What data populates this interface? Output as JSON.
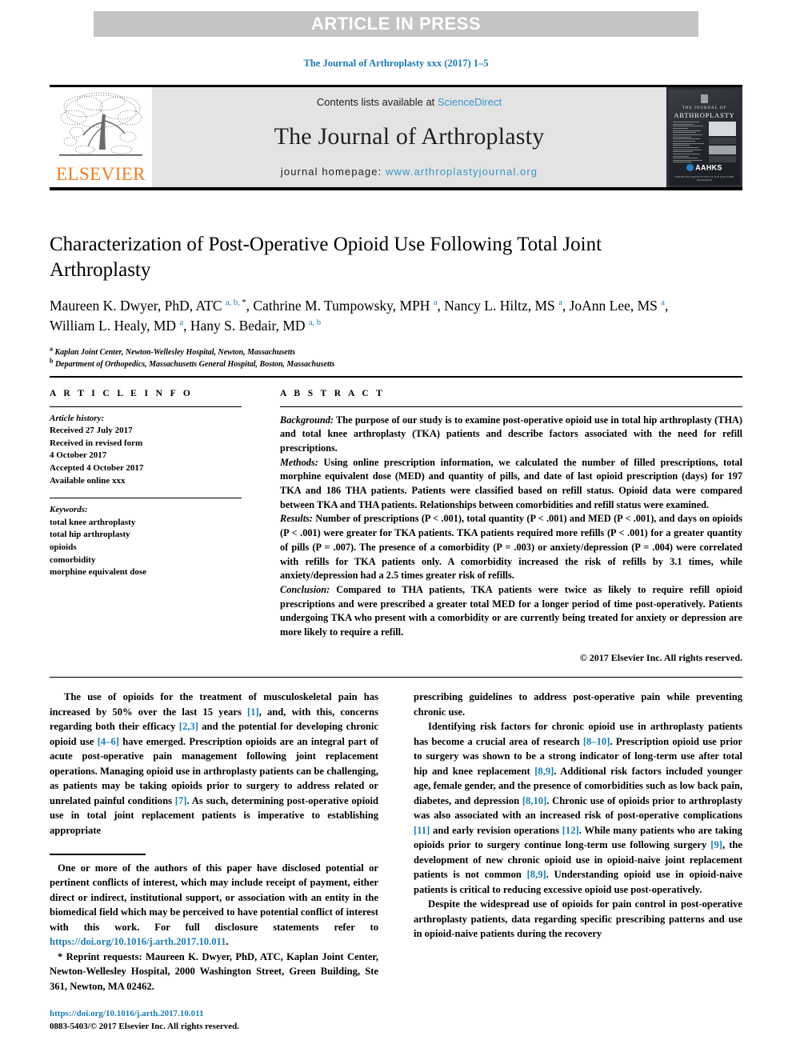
{
  "banner": {
    "text": "ARTICLE IN PRESS"
  },
  "citation": {
    "text": "The Journal of Arthroplasty xxx (2017) 1–5"
  },
  "masthead": {
    "publisher_logo_word": "ELSEVIER",
    "contents_prefix": "Contents lists available at ",
    "contents_link": "ScienceDirect",
    "journal_title": "The Journal of Arthroplasty",
    "homepage_prefix": "journal homepage: ",
    "homepage_link": "www.arthroplastyjournal.org",
    "cover": {
      "line1": "THE JOURNAL OF",
      "line2": "ARTHROPLASTY",
      "society": "AAHKS",
      "society_sub": "AMERICAN ASSOCIATION OF HIP AND KNEE SURGEONS"
    },
    "link_color": "#3a95c7",
    "logo_color": "#ef7d21"
  },
  "article": {
    "title": "Characterization of Post-Operative Opioid Use Following Total Joint Arthroplasty",
    "authors_html": "Maureen K. Dwyer, PhD, ATC <sup>a, b, </sup><sup class=\"star\">*</sup>, Cathrine M. Tumpowsky, MPH <sup>a</sup>, Nancy L. Hiltz, MS <sup>a</sup>, JoAnn Lee, MS <sup>a</sup>, William L. Healy, MD <sup>a</sup>, Hany S. Bedair, MD <sup>a, b</sup>",
    "affiliations": [
      {
        "marker": "a",
        "text": "Kaplan Joint Center, Newton-Wellesley Hospital, Newton, Massachusetts"
      },
      {
        "marker": "b",
        "text": "Department of Orthopedics, Massachusetts General Hospital, Boston, Massachusetts"
      }
    ]
  },
  "article_info": {
    "heading": "A R T I C L E    I N F O",
    "history_label": "Article history:",
    "history": [
      "Received 27 July 2017",
      "Received in revised form",
      "4 October 2017",
      "Accepted 4 October 2017",
      "Available online xxx"
    ],
    "keywords_label": "Keywords:",
    "keywords": [
      "total knee arthroplasty",
      "total hip arthroplasty",
      "opioids",
      "comorbidity",
      "morphine equivalent dose"
    ]
  },
  "abstract": {
    "heading": "A B S T R A C T",
    "sections": [
      {
        "label": "Background:",
        "text": " The purpose of our study is to examine post-operative opioid use in total hip arthroplasty (THA) and total knee arthroplasty (TKA) patients and describe factors associated with the need for refill prescriptions."
      },
      {
        "label": "Methods:",
        "text": " Using online prescription information, we calculated the number of filled prescriptions, total morphine equivalent dose (MED) and quantity of pills, and date of last opioid prescription (days) for 197 TKA and 186 THA patients. Patients were classified based on refill status. Opioid data were compared between TKA and THA patients. Relationships between comorbidities and refill status were examined."
      },
      {
        "label": "Results:",
        "text": " Number of prescriptions (P < .001), total quantity (P < .001) and MED (P < .001), and days on opioids (P < .001) were greater for TKA patients. TKA patients required more refills (P < .001) for a greater quantity of pills (P = .007). The presence of a comorbidity (P = .003) or anxiety/depression (P = .004) were correlated with refills for TKA patients only. A comorbidity increased the risk of refills by 3.1 times, while anxiety/depression had a 2.5 times greater risk of refills."
      },
      {
        "label": "Conclusion:",
        "text": " Compared to THA patients, TKA patients were twice as likely to require refill opioid prescriptions and were prescribed a greater total MED for a longer period of time post-operatively. Patients undergoing TKA who present with a comorbidity or are currently being treated for anxiety or depression are more likely to require a refill."
      }
    ],
    "copyright": "© 2017 Elsevier Inc. All rights reserved."
  },
  "body": {
    "left_paragraphs": [
      "The use of opioids for the treatment of musculoskeletal pain has increased by 50% over the last 15 years [1], and, with this, concerns regarding both their efficacy [2,3] and the potential for developing chronic opioid use [4–6] have emerged. Prescription opioids are an integral part of acute post-operative pain management following joint replacement operations. Managing opioid use in arthroplasty patients can be challenging, as patients may be taking opioids prior to surgery to address related or unrelated painful conditions [7]. As such, determining post-operative opioid use in total joint replacement patients is imperative to establishing appropriate"
    ],
    "right_paragraphs": [
      "prescribing guidelines to address post-operative pain while preventing chronic use.",
      "Identifying risk factors for chronic opioid use in arthroplasty patients has become a crucial area of research [8–10]. Prescription opioid use prior to surgery was shown to be a strong indicator of long-term use after total hip and knee replacement [8,9]. Additional risk factors included younger age, female gender, and the presence of comorbidities such as low back pain, diabetes, and depression [8,10]. Chronic use of opioids prior to arthroplasty was also associated with an increased risk of post-operative complications [11] and early revision operations [12]. While many patients who are taking opioids prior to surgery continue long-term use following surgery [9], the development of new chronic opioid use in opioid-naive joint replacement patients is not common [8,9]. Understanding opioid use in opioid-naive patients is critical to reducing excessive opioid use post-operatively.",
      "Despite the widespread use of opioids for pain control in post-operative arthroplasty patients, data regarding specific prescribing patterns and use in opioid-naive patients during the recovery"
    ]
  },
  "footnotes": {
    "conflict": "One or more of the authors of this paper have disclosed potential or pertinent conflicts of interest, which may include receipt of payment, either direct or indirect, institutional support, or association with an entity in the biomedical field which may be perceived to have potential conflict of interest with this work. For full disclosure statements refer to ",
    "conflict_link": "https://doi.org/10.1016/j.arth.2017.10.011",
    "conflict_tail": ".",
    "reprint_marker": "*",
    "reprint": " Reprint requests: Maureen K. Dwyer, PhD, ATC, Kaplan Joint Center, Newton-Wellesley Hospital, 2000 Washington Street, Green Building, Ste 361, Newton, MA 02462.",
    "doi_link": "https://doi.org/10.1016/j.arth.2017.10.011",
    "issn_line": "0883-5403/© 2017 Elsevier Inc. All rights reserved."
  }
}
